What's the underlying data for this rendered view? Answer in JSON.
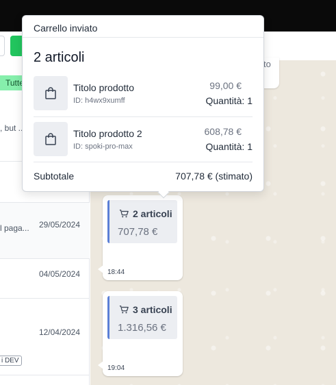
{
  "left_panel": {
    "filter_label": "Tutte",
    "rows": [
      {
        "snippet": ", but ...",
        "date": ""
      },
      {
        "snippet": "l paga...",
        "date": "29/05/2024"
      },
      {
        "snippet": "",
        "date": "04/05/2024"
      },
      {
        "snippet": "",
        "date": "12/04/2024",
        "badge": "i DEV"
      }
    ]
  },
  "chat": {
    "peek_text": "to",
    "messages": [
      {
        "cart_label": "2 articoli",
        "total": "707,78 €",
        "time": "18:44"
      },
      {
        "cart_label": "3 articoli",
        "total": "1.316,56 €",
        "time": "19:04"
      }
    ]
  },
  "popover": {
    "title": "Carrello inviato",
    "count": "2 articoli",
    "items": [
      {
        "name": "Titolo prodotto",
        "id": "ID: h4wx9xumff",
        "price": "99,00 €",
        "qty": "Quantità: 1"
      },
      {
        "name": "Titolo prodotto 2",
        "id": "ID: spoki-pro-max",
        "price": "608,78 €",
        "qty": "Quantità: 1"
      }
    ],
    "subtotal_label": "Subtotale",
    "subtotal_value": "707,78 € (stimato)"
  },
  "icons": {
    "cart": "shopping-cart-icon",
    "bag": "shopping-bag-icon"
  },
  "colors": {
    "accent_green": "#22c55e",
    "filter_pill": "#86efac",
    "cart_border": "#5b7fd6",
    "chat_bg": "#ede8de"
  }
}
